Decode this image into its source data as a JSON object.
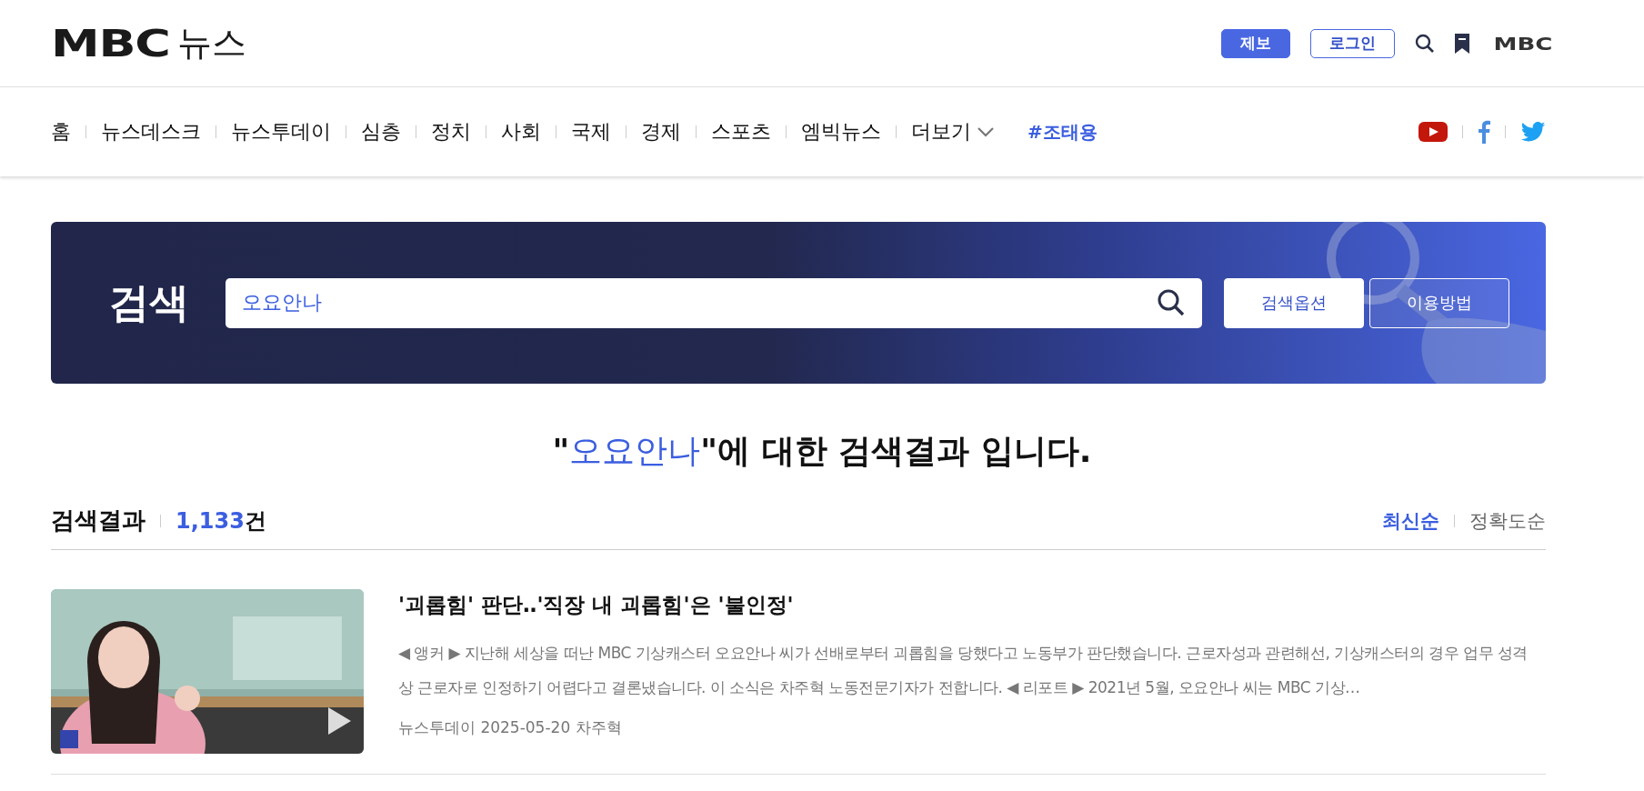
{
  "header": {
    "logo_mark": "MBC",
    "logo_text": "뉴스",
    "report_button": "제보",
    "login_button": "로그인",
    "brand_link": "MBC"
  },
  "nav": {
    "items": [
      {
        "label": "홈"
      },
      {
        "label": "뉴스데스크"
      },
      {
        "label": "뉴스투데이"
      },
      {
        "label": "심층"
      },
      {
        "label": "정치"
      },
      {
        "label": "사회"
      },
      {
        "label": "국제"
      },
      {
        "label": "경제"
      },
      {
        "label": "스포츠"
      },
      {
        "label": "엠빅뉴스"
      },
      {
        "label": "더보기",
        "kind": "dropdown"
      }
    ],
    "trending": "#조태용"
  },
  "search": {
    "title": "검색",
    "value": "오요안나",
    "options_button": "검색옵션",
    "help_button": "이용방법"
  },
  "result_heading": {
    "quote_open": "\"",
    "query": "오요안나",
    "rest": "\"에 대한 검색결과 입니다."
  },
  "results_bar": {
    "label": "검색결과",
    "count": "1,133",
    "unit": "건",
    "sort": [
      {
        "label": "최신순",
        "selected": true
      },
      {
        "label": "정확도순",
        "selected": false
      }
    ]
  },
  "results": [
    {
      "title": "'괴롭힘' 판단‥'직장 내 괴롭힘'은 '불인정'",
      "summary": "◀ 앵커 ▶ 지난해 세상을 떠난 MBC 기상캐스터 오요안나 씨가 선배로부터 괴롭힘을 당했다고 노동부가 판단했습니다. 근로자성과 관련해선, 기상캐스터의 경우 업무 성격 상 근로자로 인정하기 어렵다고 결론냈습니다. 이 소식은 차주혁 노동전문기자가 전합니다. ◀ 리포트 ▶ 2021년 5월, 오요안나 씨는 MBC 기상…",
      "meta": "뉴스투데이 2025-05-20 차주혁"
    }
  ]
}
